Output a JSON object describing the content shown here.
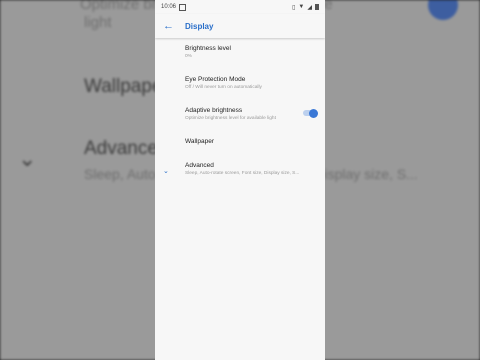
{
  "status_bar": {
    "time": "10:06"
  },
  "header": {
    "title": "Display"
  },
  "items": [
    {
      "title": "Brightness level",
      "subtitle": "0%"
    },
    {
      "title": "Eye Protection Mode",
      "subtitle": "Off / Will never turn on automatically"
    },
    {
      "title": "Adaptive brightness",
      "subtitle": "Optimize brightness level for available light",
      "toggle": "on"
    },
    {
      "title": "Wallpaper",
      "subtitle": ""
    },
    {
      "title": "Advanced",
      "subtitle": "Sleep, Auto-rotate screen, Font size, Display size, S..."
    }
  ],
  "background": {
    "optimize_line": "Optimize brightness level for available",
    "light_line": "light",
    "wallpaper": "Wallpaper",
    "advanced": "Advanced",
    "advanced_sub": "Sleep, Auto-rotate screen, Font size, Display size, S..."
  },
  "colors": {
    "accent": "#2a6fc9",
    "toggle_on": "#3a78d6"
  }
}
